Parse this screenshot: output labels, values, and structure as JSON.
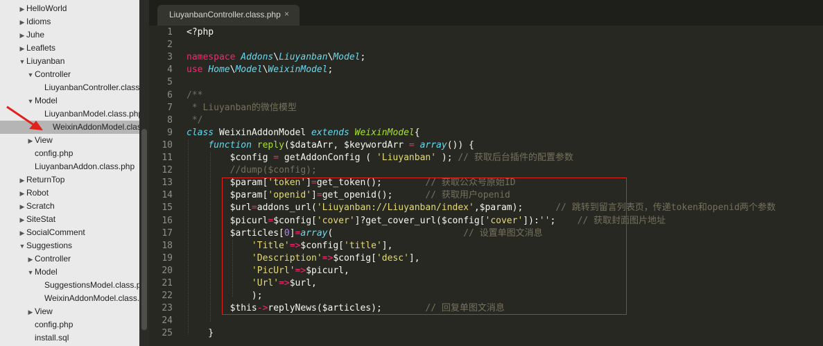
{
  "sidebar": {
    "items": [
      {
        "label": "HelloWorld",
        "depth": 0,
        "arrow": "▶"
      },
      {
        "label": "Idioms",
        "depth": 0,
        "arrow": "▶"
      },
      {
        "label": "Juhe",
        "depth": 0,
        "arrow": "▶"
      },
      {
        "label": "Leaflets",
        "depth": 0,
        "arrow": "▶"
      },
      {
        "label": "Liuyanban",
        "depth": 0,
        "arrow": "▼"
      },
      {
        "label": "Controller",
        "depth": 1,
        "arrow": "▼"
      },
      {
        "label": "LiuyanbanController.class.p",
        "depth": 2,
        "arrow": ""
      },
      {
        "label": "Model",
        "depth": 1,
        "arrow": "▼"
      },
      {
        "label": "LiuyanbanModel.class.php",
        "depth": 2,
        "arrow": ""
      },
      {
        "label": "WeixinAddonModel.class.p",
        "depth": 2,
        "arrow": ""
      },
      {
        "label": "View",
        "depth": 1,
        "arrow": "▶"
      },
      {
        "label": "config.php",
        "depth": 1,
        "arrow": ""
      },
      {
        "label": "LiuyanbanAddon.class.php",
        "depth": 1,
        "arrow": ""
      },
      {
        "label": "ReturnTop",
        "depth": 0,
        "arrow": "▶"
      },
      {
        "label": "Robot",
        "depth": 0,
        "arrow": "▶"
      },
      {
        "label": "Scratch",
        "depth": 0,
        "arrow": "▶"
      },
      {
        "label": "SiteStat",
        "depth": 0,
        "arrow": "▶"
      },
      {
        "label": "SocialComment",
        "depth": 0,
        "arrow": "▶"
      },
      {
        "label": "Suggestions",
        "depth": 0,
        "arrow": "▼"
      },
      {
        "label": "Controller",
        "depth": 1,
        "arrow": "▶"
      },
      {
        "label": "Model",
        "depth": 1,
        "arrow": "▼"
      },
      {
        "label": "SuggestionsModel.class.ph",
        "depth": 2,
        "arrow": ""
      },
      {
        "label": "WeixinAddonModel.class.p",
        "depth": 2,
        "arrow": ""
      },
      {
        "label": "View",
        "depth": 1,
        "arrow": "▶"
      },
      {
        "label": "config.php",
        "depth": 1,
        "arrow": ""
      },
      {
        "label": "install.sql",
        "depth": 1,
        "arrow": ""
      }
    ],
    "selected_index": 9
  },
  "tab": {
    "label": "LiuyanbanController.class.php",
    "close": "×"
  },
  "code_lines": [
    [
      [
        "",
        "<?php"
      ]
    ],
    [],
    [
      [
        "k",
        "namespace"
      ],
      [
        "",
        " "
      ],
      [
        "kb",
        "Addons"
      ],
      [
        "",
        "\\"
      ],
      [
        "kb",
        "Liuyanban"
      ],
      [
        "",
        "\\"
      ],
      [
        "kb",
        "Model"
      ],
      [
        "",
        ";"
      ]
    ],
    [
      [
        "k",
        "use"
      ],
      [
        "",
        " "
      ],
      [
        "kb",
        "Home"
      ],
      [
        "",
        "\\"
      ],
      [
        "kb",
        "Model"
      ],
      [
        "",
        "\\"
      ],
      [
        "kb",
        "WeixinModel"
      ],
      [
        "",
        ";"
      ]
    ],
    [],
    [
      [
        "c",
        "/**"
      ]
    ],
    [
      [
        "c",
        " * Liuyanban的微信模型"
      ]
    ],
    [
      [
        "c",
        " */"
      ]
    ],
    [
      [
        "kb",
        "class"
      ],
      [
        "",
        " WeixinAddonModel "
      ],
      [
        "kb",
        "extends"
      ],
      [
        "",
        " "
      ],
      [
        "fi",
        "WeixinModel"
      ],
      [
        "",
        "{"
      ]
    ],
    [
      [
        "",
        "    "
      ],
      [
        "kb",
        "function"
      ],
      [
        "",
        " "
      ],
      [
        "f",
        "reply"
      ],
      [
        "",
        "($dataArr, $keywordArr "
      ],
      [
        "k",
        "="
      ],
      [
        "",
        " "
      ],
      [
        "kb",
        "array"
      ],
      [
        "",
        "()) {"
      ]
    ],
    [
      [
        "",
        "        $config "
      ],
      [
        "k",
        "="
      ],
      [
        "",
        " getAddonConfig ( "
      ],
      [
        "s",
        "'Liuyanban'"
      ],
      [
        "",
        " ); "
      ],
      [
        "c",
        "// 获取后台插件的配置参数"
      ]
    ],
    [
      [
        "",
        "        "
      ],
      [
        "c",
        "//dump($config);"
      ]
    ],
    [
      [
        "",
        "        $param["
      ],
      [
        "s",
        "'token'"
      ],
      [
        "",
        "]"
      ],
      [
        "k",
        "="
      ],
      [
        "",
        "get_token();        "
      ],
      [
        "c",
        "// 获取公众号原始ID"
      ]
    ],
    [
      [
        "",
        "        $param["
      ],
      [
        "s",
        "'openid'"
      ],
      [
        "",
        "]"
      ],
      [
        "k",
        "="
      ],
      [
        "",
        "get_openid();      "
      ],
      [
        "c",
        "// 获取用户openid"
      ]
    ],
    [
      [
        "",
        "        $url"
      ],
      [
        "k",
        "="
      ],
      [
        "",
        "addons_url("
      ],
      [
        "s",
        "'Liuyanban://Liuyanban/index'"
      ],
      [
        "",
        ",$param);      "
      ],
      [
        "c",
        "// 跳转到留言列表页，传递token和openid两个参数"
      ]
    ],
    [
      [
        "",
        "        $picurl"
      ],
      [
        "k",
        "="
      ],
      [
        "",
        "$config["
      ],
      [
        "s",
        "'cover'"
      ],
      [
        "",
        "]?get_cover_url($config["
      ],
      [
        "s",
        "'cover'"
      ],
      [
        "",
        "]):"
      ],
      [
        "s",
        "''"
      ],
      [
        "",
        ";    "
      ],
      [
        "c",
        "// 获取封面图片地址"
      ]
    ],
    [
      [
        "",
        "        $articles["
      ],
      [
        "num",
        "0"
      ],
      [
        "",
        "]"
      ],
      [
        "k",
        "="
      ],
      [
        "kb",
        "array"
      ],
      [
        "",
        "(                        "
      ],
      [
        "c",
        "// 设置单图文消息"
      ]
    ],
    [
      [
        "",
        "            "
      ],
      [
        "s",
        "'Title'"
      ],
      [
        "k",
        "=>"
      ],
      [
        "",
        "$config["
      ],
      [
        "s",
        "'title'"
      ],
      [
        "",
        "],"
      ]
    ],
    [
      [
        "",
        "            "
      ],
      [
        "s",
        "'Description'"
      ],
      [
        "k",
        "=>"
      ],
      [
        "",
        "$config["
      ],
      [
        "s",
        "'desc'"
      ],
      [
        "",
        "],"
      ]
    ],
    [
      [
        "",
        "            "
      ],
      [
        "s",
        "'PicUrl'"
      ],
      [
        "k",
        "=>"
      ],
      [
        "",
        "$picurl,"
      ]
    ],
    [
      [
        "",
        "            "
      ],
      [
        "s",
        "'Url'"
      ],
      [
        "k",
        "=>"
      ],
      [
        "",
        "$url,"
      ]
    ],
    [
      [
        "",
        "            );"
      ]
    ],
    [
      [
        "",
        "        $this"
      ],
      [
        "k",
        "->"
      ],
      [
        "",
        "replyNews($articles);        "
      ],
      [
        "c",
        "// 回复单图文消息"
      ]
    ],
    [],
    [
      [
        "",
        "    }"
      ]
    ]
  ]
}
